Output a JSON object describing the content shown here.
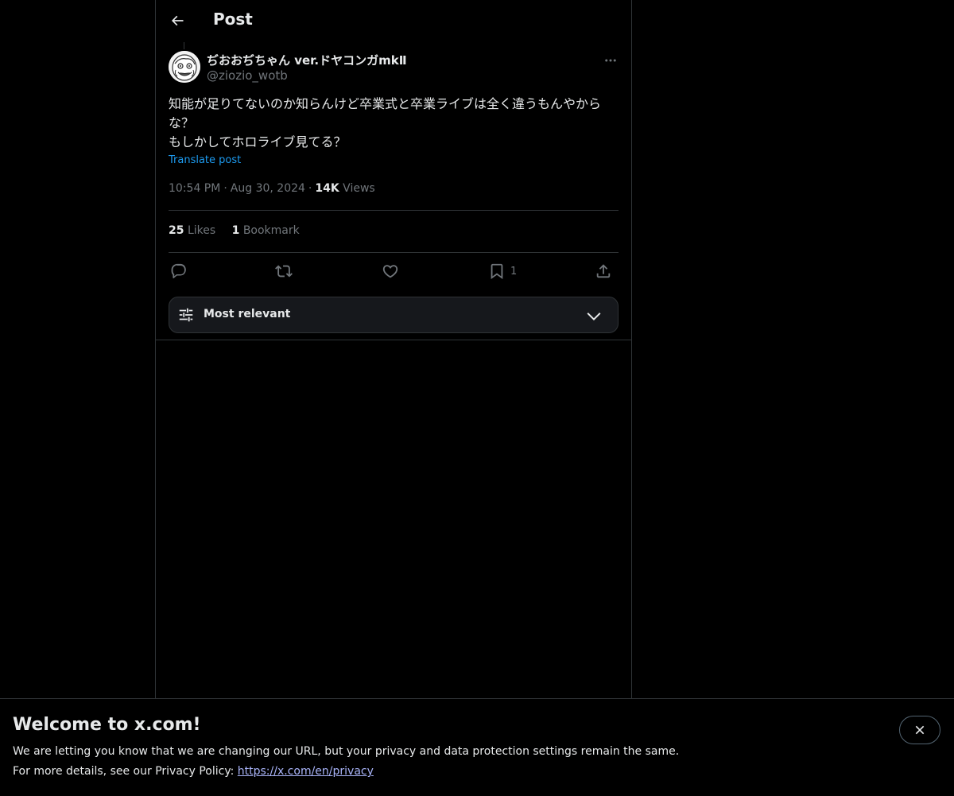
{
  "header": {
    "title": "Post"
  },
  "post": {
    "author_name": "ぢおおぢちゃん ver.ドヤコンガmkⅡ",
    "author_handle": "@ziozio_wotb",
    "text_lines": [
      "知能が足りてないのか知らんけど卒業式と卒業ライブは全く違うもんやからな？",
      "もしかしてホロライブ見てる？"
    ],
    "translate_label": "Translate post",
    "time": "10:54 PM",
    "date": "Aug 30, 2024",
    "views_count": "14K",
    "views_label": "Views",
    "likes_count": "25",
    "likes_label": "Likes",
    "bookmarks_count": "1",
    "bookmarks_label": "Bookmark",
    "bookmark_action_count": "1"
  },
  "replies_sort": {
    "label": "Most relevant"
  },
  "banner": {
    "title": "Welcome to x.com!",
    "line1": "We are letting you know that we are changing our URL, but your privacy and data protection settings remain the same.",
    "line2_prefix": "For more details, see our Privacy Policy: ",
    "link": "https://x.com/en/privacy"
  },
  "colors": {
    "background": "#000000",
    "text": "#e7e9ea",
    "muted": "#71767b",
    "accent": "#1d9bf0",
    "border": "#2f3336"
  },
  "icons": {
    "back": "arrow-left-icon",
    "more": "more-horizontal-icon",
    "reply": "reply-icon",
    "repost": "repost-icon",
    "like": "heart-icon",
    "bookmark": "bookmark-icon",
    "share": "share-icon",
    "sort": "sliders-icon",
    "chevron": "chevron-down-icon",
    "close": "close-icon"
  }
}
